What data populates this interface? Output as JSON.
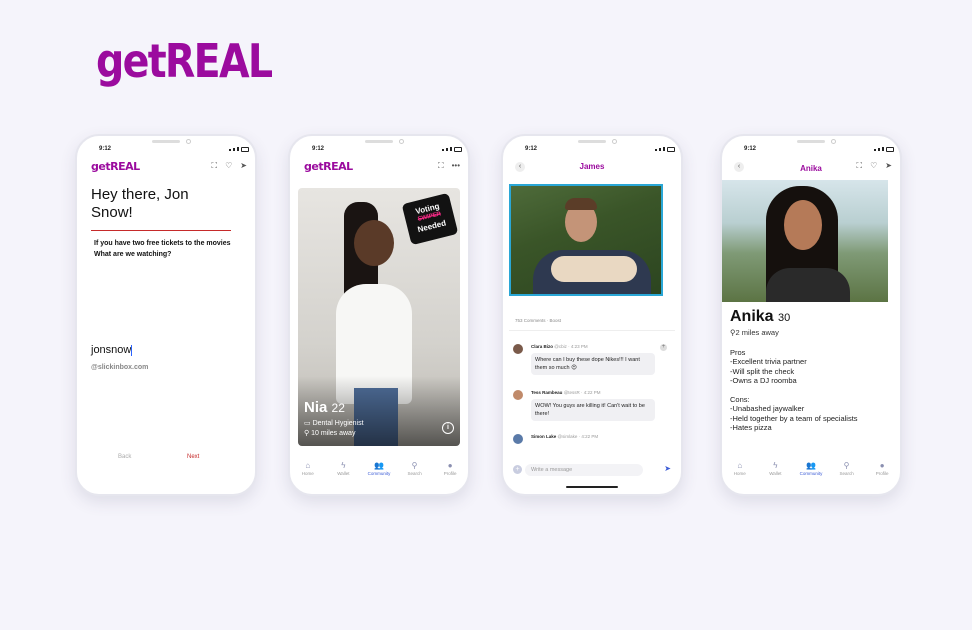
{
  "brand": {
    "logo": "getREAL",
    "accent": "#9b0b9e"
  },
  "status": {
    "time": "9:12"
  },
  "phone1": {
    "app_logo": "getREAL",
    "greeting": "Hey there, Jon Snow!",
    "question_line1": "If you have two free tickets to the movies",
    "question_line2": "What are we watching?",
    "username": "jonsnow",
    "username_hint": "@slickinbox.com",
    "back_label": "Back",
    "next_label": "Next"
  },
  "phone2": {
    "app_logo": "getREAL",
    "sticker_line1": "Voting",
    "sticker_line2": "SWIPER",
    "sticker_line3": "Needed",
    "name": "Nia",
    "age": "22",
    "job": "Dental Hygienist",
    "distance": "10 miles away",
    "info_label": "i"
  },
  "nav": {
    "home": "Home",
    "wallet": "Wallet",
    "community": "Community",
    "search": "Search",
    "profile": "Profile"
  },
  "phone3": {
    "title": "James",
    "meta": "753 Comments  ·  Boost",
    "comments": [
      {
        "name": "Clara Bizo",
        "sub": "@cbiz · 4:23 PM",
        "text": "Where can I buy these dope Nikes!!! I want them so much 😍"
      },
      {
        "name": "Tess Rambeau",
        "sub": "@tessR · 4:22 PM",
        "text": "WOW! You guys are killing it! Can't wait to be there!"
      },
      {
        "name": "Simon Lake",
        "sub": "@simlake · 4:22 PM",
        "text": ""
      }
    ],
    "compose_placeholder": "Write a message"
  },
  "phone4": {
    "title": "Anika",
    "name": "Anika",
    "age": "30",
    "distance": "2 miles away",
    "bio": "Pros\n-Excellent trivia partner\n-Will split the check\n-Owns a DJ roomba\n\nCons:\n-Unabashed jaywalker\n-Held together by a team of specialists\n-Hates pizza"
  }
}
